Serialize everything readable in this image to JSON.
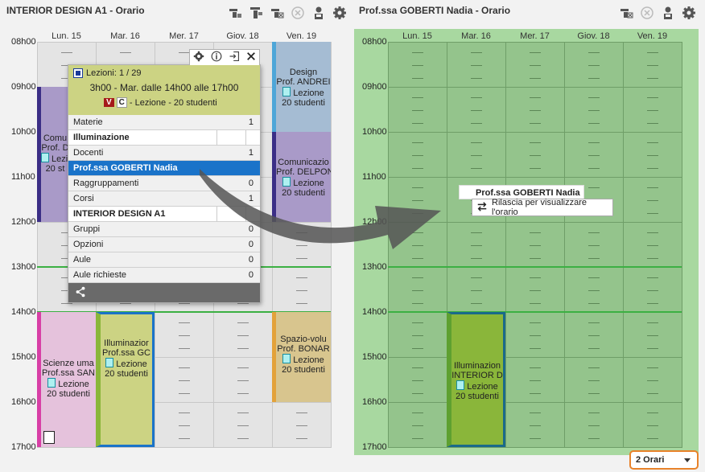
{
  "left": {
    "title": "INTERIOR DESIGN A1 - Orario",
    "days": [
      "Lun. 15",
      "Mar. 16",
      "Mer. 17",
      "Giov. 18",
      "Ven. 19"
    ],
    "hours": [
      "08h00",
      "09h00",
      "10h00",
      "11h00",
      "12h00",
      "13h00",
      "14h00",
      "15h00",
      "16h00",
      "17h00"
    ],
    "courses": [
      {
        "lines": [
          "Comu",
          "Prof. D"
        ],
        "lesson": "Lezione",
        "students": "20 st",
        "color": "#a99ac8",
        "border": "#3b2e86"
      },
      {
        "lines": [
          "Design",
          "Prof. ANDREI"
        ],
        "lesson": "Lezione",
        "students": "20 studenti",
        "color": "#a5bcd3",
        "border": "#4ea6d8"
      },
      {
        "lines": [
          "Comunicazio",
          "Prof. DELPON"
        ],
        "lesson": "Lezione",
        "students": "20 studenti",
        "color": "#a99ac8",
        "border": "#3b2e86"
      },
      {
        "lines": [
          "Scienze uma",
          "Prof.ssa SAN"
        ],
        "lesson": "Lezione",
        "students": "20 studenti",
        "color": "#e5c2dc",
        "border": "#d83fa6"
      },
      {
        "lines": [
          "Illuminazior",
          "Prof.ssa GC"
        ],
        "lesson": "Lezione",
        "students": "20 studenti",
        "color": "#ccd383",
        "border": "#1a73c9"
      },
      {
        "lines": [
          "Spazio-volu",
          "Prof. BONAR"
        ],
        "lesson": "Lezione",
        "students": "20 studenti",
        "color": "#d8c58e",
        "border": "#e3a23a"
      }
    ]
  },
  "popup": {
    "lessons": "Lezioni: 1 / 29",
    "time": "3h00 - Mar. dalle 14h00 alle 17h00",
    "badge_v": "V",
    "badge_c": "C",
    "desc": "- Lezione - 20 studenti",
    "rows": [
      {
        "label": "Materie",
        "count": "1",
        "kind": "normal"
      },
      {
        "label": "Illuminazione",
        "count": "",
        "kind": "bold"
      },
      {
        "label": "Docenti",
        "count": "1",
        "kind": "normal"
      },
      {
        "label": "Prof.ssa GOBERTI Nadia",
        "count": "",
        "kind": "sel"
      },
      {
        "label": "Raggruppamenti",
        "count": "0",
        "kind": "normal"
      },
      {
        "label": "Corsi",
        "count": "1",
        "kind": "normal"
      },
      {
        "label": "INTERIOR DESIGN A1",
        "count": "",
        "kind": "bold"
      },
      {
        "label": "Gruppi",
        "count": "0",
        "kind": "normal"
      },
      {
        "label": "Opzioni",
        "count": "0",
        "kind": "normal"
      },
      {
        "label": "Aule",
        "count": "0",
        "kind": "normal"
      },
      {
        "label": "Aule richieste",
        "count": "0",
        "kind": "normal"
      }
    ]
  },
  "right": {
    "title": "Prof.ssa GOBERTI Nadia - Orario",
    "course": {
      "lines": [
        "Illuminazion",
        "INTERIOR D"
      ],
      "lesson": "Lezione",
      "students": "20 studenti"
    },
    "drag_label": "Prof.ssa GOBERTI Nadia",
    "drag_hint": "Rilascia per visualizzare l'orario"
  },
  "footer": {
    "orari_select": "2 Orari"
  }
}
